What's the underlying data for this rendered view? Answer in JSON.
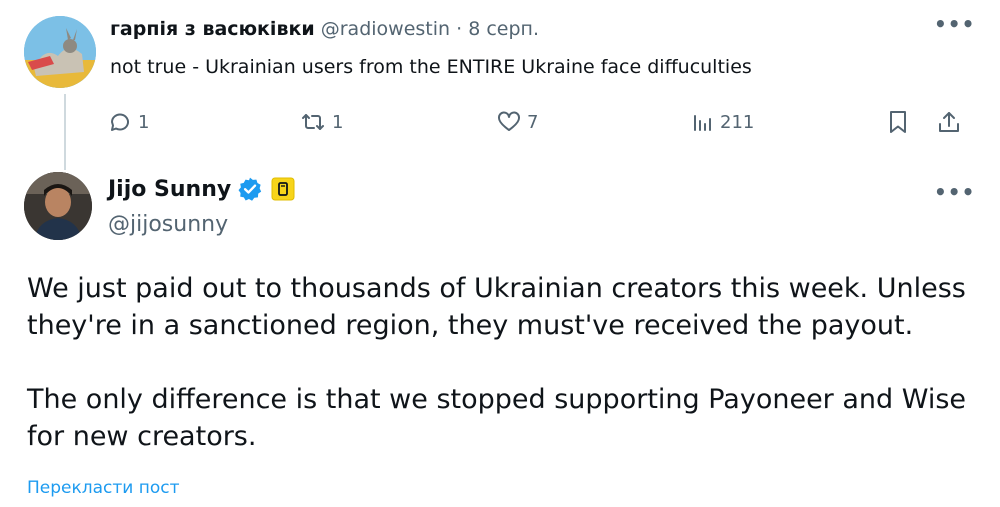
{
  "reply_tweet": {
    "author_name": "гарпія з васюківки",
    "handle": "@radiowestin",
    "separator": "·",
    "date": "8 серп.",
    "text": "not true - Ukrainian users from the ENTIRE Ukraine face diffuculties",
    "more": "•••",
    "stats": {
      "replies": "1",
      "reposts": "1",
      "likes": "7",
      "views": "211"
    }
  },
  "main_tweet": {
    "author_name": "Jijo Sunny",
    "handle": "@jijosunny",
    "more": "•••",
    "paragraphs": [
      "We just paid out to thousands of Ukrainian creators this week. Unless they're in a sanctioned region, they must've received the payout.",
      "The only difference is that we stopped supporting Payoneer and Wise for new creators."
    ],
    "translate_link": "Перекласти пост"
  },
  "colors": {
    "text": "#0f1419",
    "muted": "#536471",
    "accent": "#1d9bf0",
    "badge": "#f7d41a"
  },
  "icons": [
    "reply-icon",
    "repost-icon",
    "like-icon",
    "views-icon",
    "bookmark-icon",
    "share-icon",
    "verified-icon",
    "affiliate-badge-icon",
    "more-icon"
  ]
}
